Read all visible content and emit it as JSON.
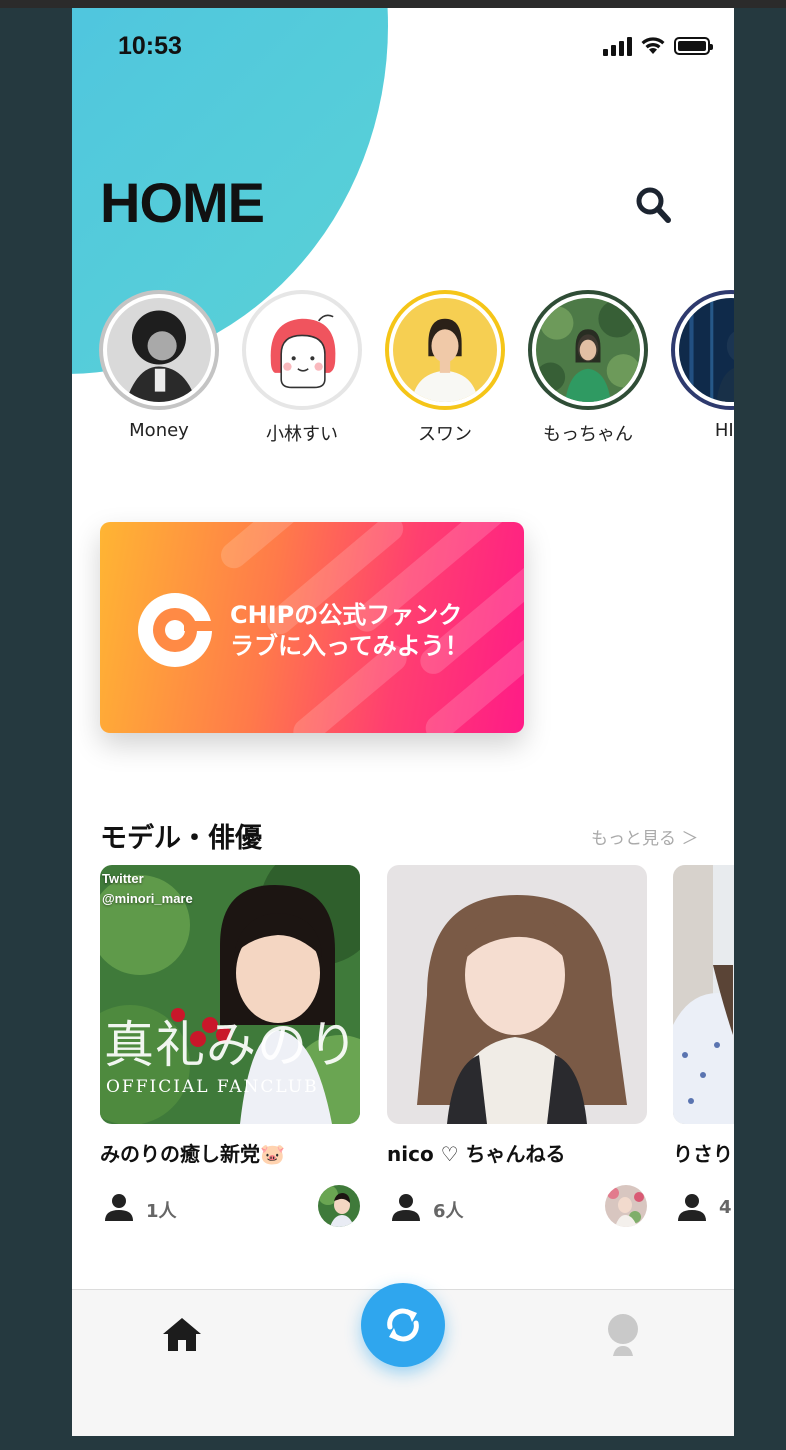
{
  "status_bar": {
    "time": "10:53"
  },
  "header": {
    "title": "HOME",
    "search_icon": "search-icon"
  },
  "stories": [
    {
      "name": "Money",
      "ring_color": "#c4c4c4"
    },
    {
      "name": "小林すい",
      "ring_color": "#e6e6e6"
    },
    {
      "name": "スワン",
      "ring_color": "#f5c518"
    },
    {
      "name": "もっちゃん",
      "ring_color": "#2f4d36"
    },
    {
      "name": "HIN",
      "ring_color": "#2e3a6e"
    }
  ],
  "banner": {
    "line1": "CHIPの公式ファンク",
    "line2": "ラブに入ってみよう！"
  },
  "section": {
    "title": "モデル・俳優",
    "more_label": "もっと見る ＞"
  },
  "cards": [
    {
      "title": "みのりの癒し新党🐷",
      "members": "1人",
      "overlay_twitter": "Twitter",
      "overlay_handle": "@minori_mare",
      "overlay_name": "真礼みのり",
      "overlay_sub": "OFFICIAL FANCLUB"
    },
    {
      "title": "nico ♡ ちゃんねる",
      "members": "6人"
    },
    {
      "title": "りさり",
      "members": "4"
    }
  ],
  "tabbar": {
    "home_icon": "home-icon",
    "center_icon": "refresh-icon",
    "profile_icon": "profile-icon"
  },
  "colors": {
    "accent_blue": "#2fa6ee",
    "blob": "#52c9dc",
    "banner_start": "#ffb533",
    "banner_end": "#ff1b87"
  }
}
